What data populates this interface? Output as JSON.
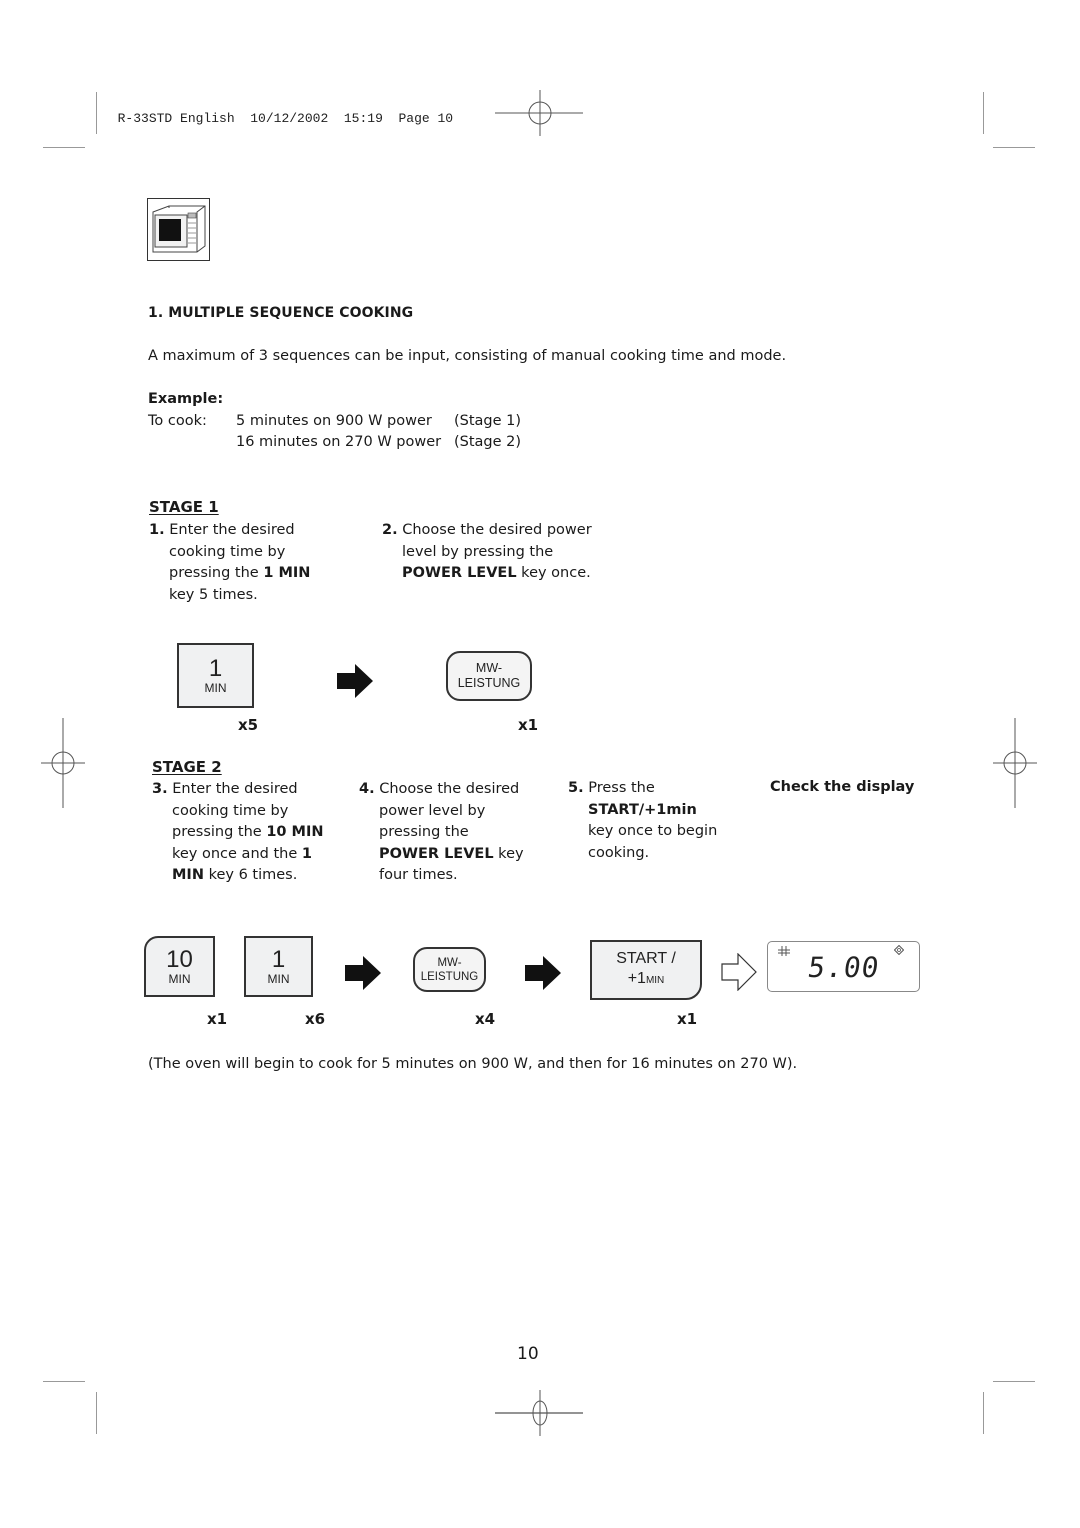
{
  "print_header": {
    "model": "R-33STD",
    "language": "English",
    "date": "10/12/2002",
    "time": "15:19",
    "page_label": "Page 10"
  },
  "section_icon": "microwave-oven-icon",
  "section": {
    "title": "1. MULTIPLE SEQUENCE COOKING",
    "intro": "A maximum of 3 sequences can be input, consisting of manual cooking time and mode.",
    "example_label": "Example:",
    "example_prefix": "To cook:",
    "example_rows": [
      {
        "text": "5 minutes on 900 W power",
        "stage": "(Stage 1)"
      },
      {
        "text": "16 minutes on 270 W power",
        "stage": "(Stage 2)"
      }
    ]
  },
  "stage1": {
    "title": "STAGE 1",
    "steps": [
      {
        "num": "1.",
        "lines": [
          "Enter the desired",
          "cooking time by"
        ],
        "l3a": "pressing the ",
        "l3b": "1 MIN",
        "l4": "key 5 times."
      },
      {
        "num": "2.",
        "lines": [
          "Choose the desired power",
          "level by pressing the"
        ],
        "l3a": "POWER LEVEL",
        "l3b": " key once."
      }
    ],
    "keys": [
      {
        "main": "1",
        "sub": "MIN",
        "count": "x5"
      },
      {
        "line1": "MW-",
        "line2": "LEISTUNG",
        "count": "x1"
      }
    ]
  },
  "stage2": {
    "title": "STAGE 2",
    "step3": {
      "num": "3.",
      "l1": "Enter the desired",
      "l2": "cooking time by",
      "l3a": "pressing the ",
      "l3b": "10 MIN",
      "l4a": "key once and the ",
      "l4b": "1",
      "l5a": "MIN",
      "l5b": " key 6 times."
    },
    "step4": {
      "num": "4.",
      "l1": "Choose the desired",
      "l2": "power level by",
      "l3": "pressing the",
      "l4a": "POWER LEVEL",
      "l4b": " key",
      "l5": "four times."
    },
    "step5": {
      "num": "5.",
      "l1": "Press the",
      "l2": "START/+1min",
      "l3": "key once to begin",
      "l4": "cooking."
    },
    "check_display": "Check the display",
    "keys": {
      "ten_min": {
        "main": "10",
        "sub": "MIN",
        "count": "x1"
      },
      "one_min": {
        "main": "1",
        "sub": "MIN",
        "count": "x6"
      },
      "power": {
        "line1": "MW-",
        "line2": "LEISTUNG",
        "count": "x4"
      },
      "start": {
        "line1": "START /",
        "line2": "+1",
        "line2_small": "MIN",
        "count": "x1"
      }
    },
    "display": {
      "value": "5.00",
      "left_indicator": "microwave-indicator-icon",
      "right_indicator": "diamond-indicator-icon"
    }
  },
  "summary": "(The oven will begin to cook for 5 minutes on 900 W, and then for 16 minutes on 270 W).",
  "page_number": "10"
}
